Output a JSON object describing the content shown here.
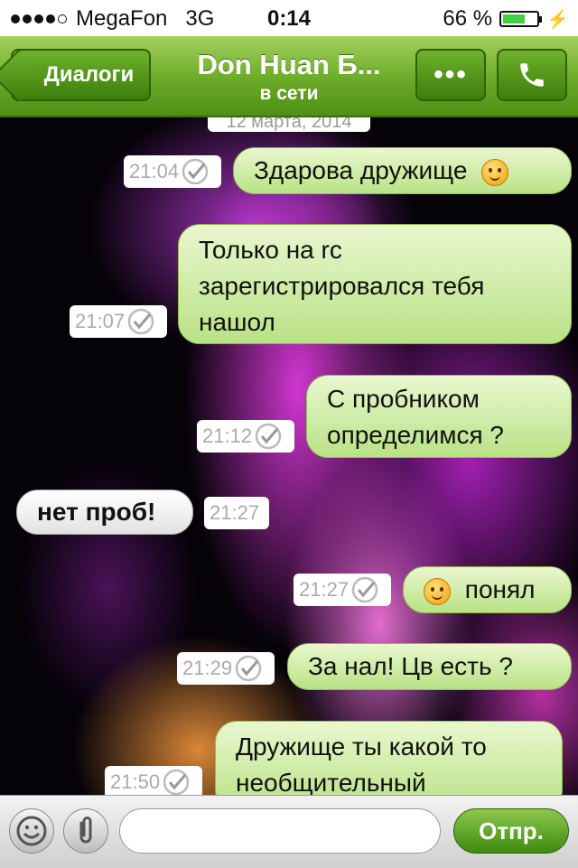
{
  "status_bar": {
    "carrier": "MegaFon",
    "network": "3G",
    "time": "0:14",
    "battery_text": "66 %",
    "battery_level": 0.66,
    "signal_bars": 4
  },
  "nav": {
    "back_label": "Диалоги",
    "title": "Don Huan Б...",
    "subtitle": "в сети",
    "more_label": "•••",
    "call_icon": "phone-icon"
  },
  "chat": {
    "date": "12 марта, 2014",
    "messages": [
      {
        "direction": "out",
        "text": "Здарова дружище",
        "time": "21:04",
        "emoji": "smile-emoji-end"
      },
      {
        "direction": "out",
        "text": "Только на rc зарегистрировался тебя нашол",
        "time": "21:07"
      },
      {
        "direction": "out",
        "text": "С пробником определимся ?",
        "time": "21:12"
      },
      {
        "direction": "in",
        "text": "нет проб!",
        "time": "21:27"
      },
      {
        "direction": "out",
        "text": "понял",
        "time": "21:27",
        "emoji": "smile-emoji-start"
      },
      {
        "direction": "out",
        "text": "За нал! Цв есть ?",
        "time": "21:29"
      },
      {
        "direction": "out",
        "text": "Дружище ты какой то необщительный",
        "time": "21:50"
      }
    ]
  },
  "input_bar": {
    "placeholder": "",
    "send_label": "Отпр.",
    "emoji_icon": "smiley-icon",
    "attach_icon": "paperclip-icon"
  },
  "colors": {
    "nav_green": "#6fae2b",
    "outgoing_bubble": "#c9ea9d",
    "incoming_bubble": "#f0f0f0",
    "battery_fill": "#3fd13f"
  }
}
